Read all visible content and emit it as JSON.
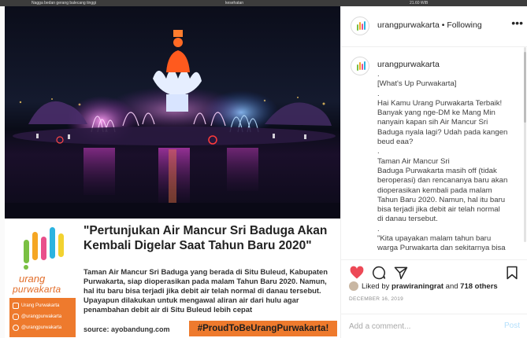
{
  "top_strip": {
    "left_text": "Nagga bedan gerang balecang tinggi",
    "mid_text": "kesehatan",
    "right_text": "21.60 WIB"
  },
  "post": {
    "card": {
      "logo_word1": "urang",
      "logo_word2": "purwakarta",
      "socials": [
        {
          "icon": "facebook-icon",
          "label": "Urang Purwakarta"
        },
        {
          "icon": "instagram-icon",
          "label": "@urangpurwakarta"
        },
        {
          "icon": "twitter-icon",
          "label": "@urangpurwakarta"
        }
      ],
      "headline": "\"Pertunjukan Air Mancur Sri Baduga Akan Kembali Digelar Saat Tahun Baru 2020\"",
      "body": "Taman Air Mancur Sri Baduga yang berada di Situ Buleud, Kabupaten Purwakarta, siap dioperasikan pada malam Tahun Baru 2020. Namun, hal itu baru bisa terjadi jika debit air telah normal di danau tersebut. Upayapun dilakukan untuk mengawal aliran air dari hulu agar penambahan debit air di Situ Buleud lebih cepat",
      "source": "source: ayobandung.com",
      "hashtag": "#ProudToBeUrangPurwakarta!",
      "accent": "#ee7a2d"
    }
  },
  "panel": {
    "header": {
      "username": "urangpurwakarta",
      "separator": "•",
      "follow_state": "Following",
      "more": "•••"
    },
    "caption": {
      "username": "urangpurwakarta",
      "lines": [
        ".",
        "[What's Up Purwakarta]",
        ".",
        "Hai Kamu Urang Purwakarta Terbaik!",
        "Banyak yang nge-DM ke Mang Min",
        "nanyain kapan sih Air Mancur Sri",
        "Baduga nyala lagi? Udah pada kangen",
        "beud eaa?",
        ".",
        "Taman Air Mancur Sri",
        "Baduga Purwakarta masih off (tidak",
        "beroperasi) dan rencananya baru akan",
        "dioperasikan kembali pada malam",
        "Tahun Baru 2020. Namun, hal itu baru",
        "bisa terjadi jika debit air telah normal",
        "di danau tersebut.",
        ".",
        "\"Kita upayakan malam tahun baru",
        "warga Purwakarta dan sekitarnya bisa"
      ]
    },
    "likes": {
      "prefix": "Liked by",
      "user": "prawiraningrat",
      "middle": "and",
      "others": "718 others"
    },
    "date": "DECEMBER 16, 2019",
    "comment": {
      "placeholder": "Add a comment...",
      "post_label": "Post"
    }
  }
}
